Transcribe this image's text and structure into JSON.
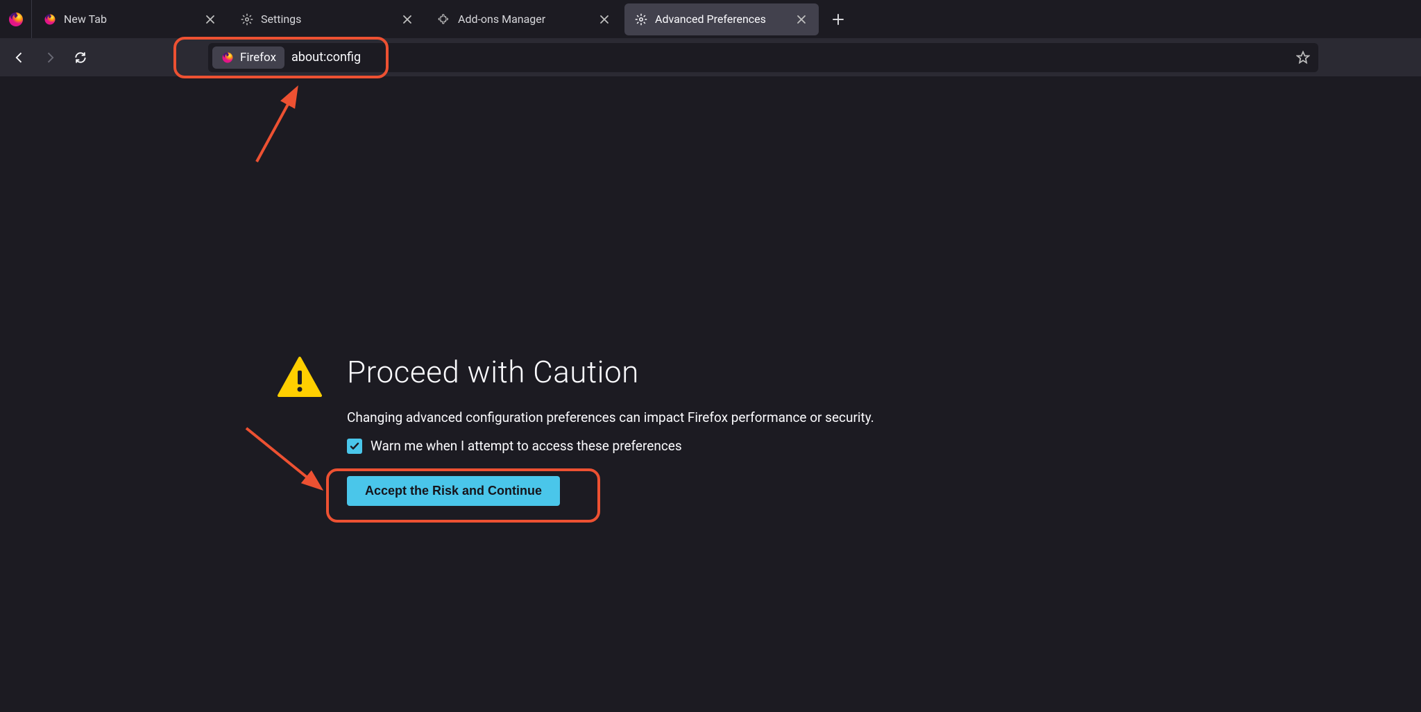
{
  "tabs": [
    {
      "label": "New Tab",
      "icon": "firefox"
    },
    {
      "label": "Settings",
      "icon": "gear"
    },
    {
      "label": "Add-ons Manager",
      "icon": "puzzle"
    },
    {
      "label": "Advanced Preferences",
      "icon": "gear",
      "active": true
    }
  ],
  "urlbar": {
    "identity_label": "Firefox",
    "url": "about:config"
  },
  "warning": {
    "title": "Proceed with Caution",
    "description": "Changing advanced configuration preferences can impact Firefox performance or security.",
    "checkbox_label": "Warn me when I attempt to access these preferences",
    "checkbox_checked": true,
    "accept_button": "Accept the Risk and Continue"
  }
}
